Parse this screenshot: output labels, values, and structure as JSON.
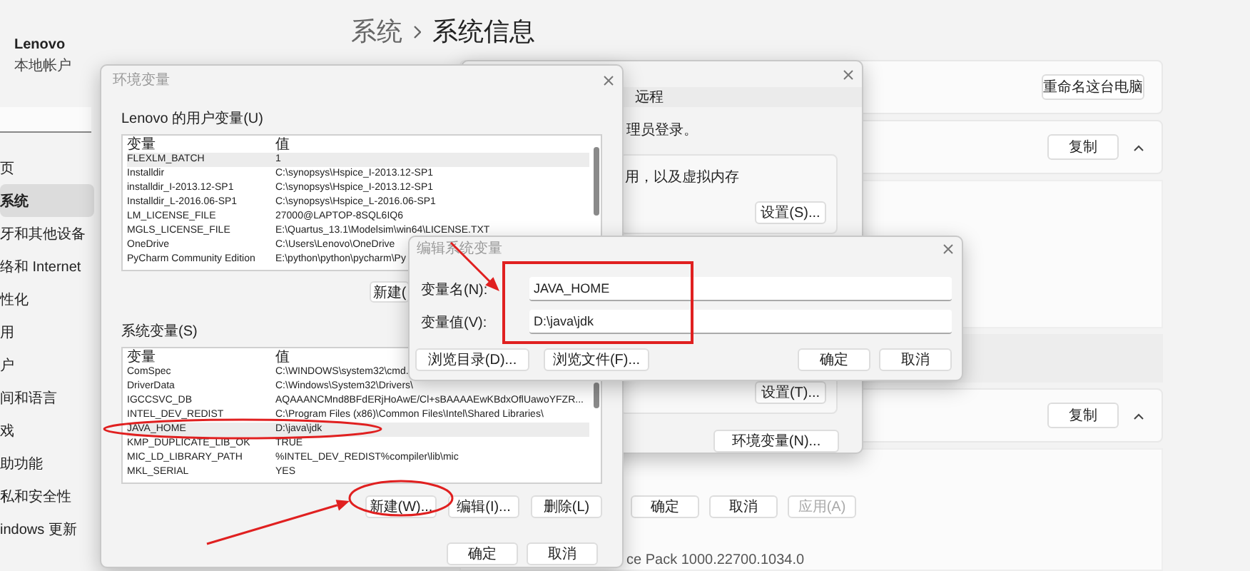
{
  "settings": {
    "account": {
      "name": "Lenovo",
      "type": "本地帐户"
    },
    "nav": [
      {
        "label": "页",
        "selected": false
      },
      {
        "label": "系统",
        "selected": true
      },
      {
        "label": "牙和其他设备",
        "selected": false
      },
      {
        "label": "络和 Internet",
        "selected": false
      },
      {
        "label": "性化",
        "selected": false
      },
      {
        "label": "用",
        "selected": false
      },
      {
        "label": "户",
        "selected": false
      },
      {
        "label": "间和语言",
        "selected": false
      },
      {
        "label": "戏",
        "selected": false
      },
      {
        "label": "助功能",
        "selected": false
      },
      {
        "label": "私和安全性",
        "selected": false
      },
      {
        "label": "indows 更新",
        "selected": false
      }
    ],
    "breadcrumb": [
      "系统",
      "系统信息"
    ],
    "rename_button": "重命名这台电脑",
    "sections": [
      {
        "copy_button": "复制",
        "expanded": true
      },
      {
        "copy_button": "复制",
        "expanded": true
      }
    ],
    "footer": "ce Pack 1000.22700.1034.0"
  },
  "system_properties": {
    "tab": "远程",
    "texts": [
      "理员登录。",
      "用，以及虚拟内存"
    ],
    "group_buttons": [
      "设置(S)...",
      "设置(T)..."
    ],
    "env_button": "环境变量(N)...",
    "dialog_buttons": [
      {
        "label": "确定",
        "disabled": false
      },
      {
        "label": "取消",
        "disabled": false
      },
      {
        "label": "应用(A)",
        "disabled": true
      }
    ]
  },
  "env_dialog": {
    "title": "环境变量",
    "user_group": {
      "label": "Lenovo 的用户变量(U)",
      "columns": [
        "变量",
        "值"
      ],
      "rows": [
        {
          "name": "FLEXLM_BATCH",
          "value": "1",
          "selected": true
        },
        {
          "name": "Installdir",
          "value": "C:\\synopsys\\Hspice_I-2013.12-SP1",
          "selected": false
        },
        {
          "name": "installdir_I-2013.12-SP1",
          "value": "C:\\synopsys\\Hspice_I-2013.12-SP1",
          "selected": false
        },
        {
          "name": "Installdir_L-2016.06-SP1",
          "value": "C:\\synopsys\\Hspice_L-2016.06-SP1",
          "selected": false
        },
        {
          "name": "LM_LICENSE_FILE",
          "value": "27000@LAPTOP-8SQL6IQ6",
          "selected": false
        },
        {
          "name": "MGLS_LICENSE_FILE",
          "value": "E:\\Quartus_13.1\\Modelsim\\win64\\LICENSE.TXT",
          "selected": false
        },
        {
          "name": "OneDrive",
          "value": "C:\\Users\\Lenovo\\OneDrive",
          "selected": false
        },
        {
          "name": "PyCharm Community Edition",
          "value": "E:\\python\\python\\pycharm\\Py",
          "selected": false
        }
      ],
      "buttons": [
        "新建("
      ]
    },
    "system_group": {
      "label": "系统变量(S)",
      "columns": [
        "变量",
        "值"
      ],
      "rows": [
        {
          "name": "ComSpec",
          "value": "C:\\WINDOWS\\system32\\cmd.",
          "selected": false
        },
        {
          "name": "DriverData",
          "value": "C:\\Windows\\System32\\Drivers\\",
          "selected": false
        },
        {
          "name": "IGCCSVC_DB",
          "value": "AQAAANCMnd8BFdERjHoAwE/Cl+sBAAAAEwKBdxOflUawoYFZR...",
          "selected": false
        },
        {
          "name": "INTEL_DEV_REDIST",
          "value": "C:\\Program Files (x86)\\Common Files\\Intel\\Shared Libraries\\",
          "selected": false
        },
        {
          "name": "JAVA_HOME",
          "value": "D:\\java\\jdk",
          "selected": true
        },
        {
          "name": "KMP_DUPLICATE_LIB_OK",
          "value": "TRUE",
          "selected": false
        },
        {
          "name": "MIC_LD_LIBRARY_PATH",
          "value": "%INTEL_DEV_REDIST%compiler\\lib\\mic",
          "selected": false
        },
        {
          "name": "MKL_SERIAL",
          "value": "YES",
          "selected": false
        }
      ],
      "buttons": [
        "新建(W)...",
        "编辑(I)...",
        "删除(L)"
      ]
    },
    "dialog_buttons": [
      "确定",
      "取消"
    ]
  },
  "edit_dialog": {
    "title": "编辑系统变量",
    "fields": [
      {
        "label": "变量名(N):",
        "value": "JAVA_HOME"
      },
      {
        "label": "变量值(V):",
        "value": "D:\\java\\jdk"
      }
    ],
    "browse_buttons": [
      "浏览目录(D)...",
      "浏览文件(F)..."
    ],
    "dialog_buttons": [
      "确定",
      "取消"
    ]
  }
}
